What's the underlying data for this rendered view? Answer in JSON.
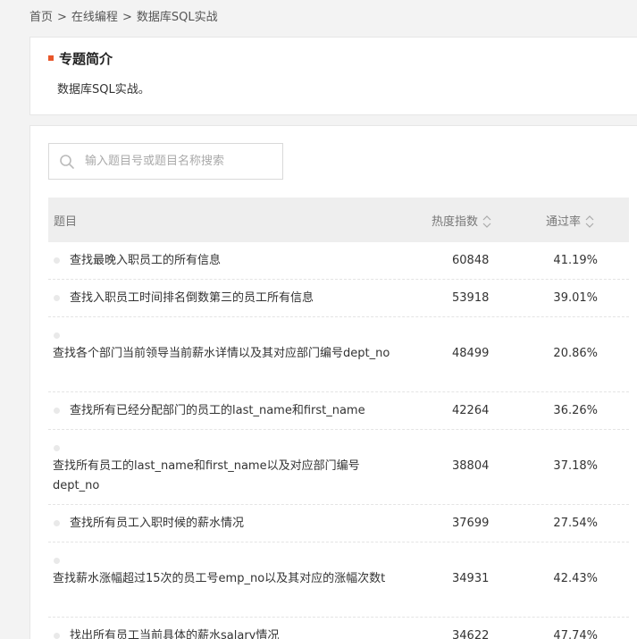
{
  "breadcrumb": {
    "home": "首页",
    "section": "在线编程",
    "current": "数据库SQL实战",
    "separator": ">"
  },
  "intro": {
    "title": "专题简介",
    "description": "数据库SQL实战。"
  },
  "search": {
    "placeholder": "输入题目号或题目名称搜索",
    "value": ""
  },
  "table": {
    "headers": {
      "title": "题目",
      "hotness": "热度指数",
      "pass_rate": "通过率"
    },
    "rows": [
      {
        "title": "查找最晚入职员工的所有信息",
        "hotness": "60848",
        "pass_rate": "41.19%"
      },
      {
        "title": "查找入职员工时间排名倒数第三的员工所有信息",
        "hotness": "53918",
        "pass_rate": "39.01%"
      },
      {
        "title": "查找各个部门当前领导当前薪水详情以及其对应部门编号dept_no",
        "hotness": "48499",
        "pass_rate": "20.86%"
      },
      {
        "title": "查找所有已经分配部门的员工的last_name和first_name",
        "hotness": "42264",
        "pass_rate": "36.26%"
      },
      {
        "title": "查找所有员工的last_name和first_name以及对应部门编号dept_no",
        "hotness": "38804",
        "pass_rate": "37.18%"
      },
      {
        "title": "查找所有员工入职时候的薪水情况",
        "hotness": "37699",
        "pass_rate": "27.54%"
      },
      {
        "title": "查找薪水涨幅超过15次的员工号emp_no以及其对应的涨幅次数t",
        "hotness": "34931",
        "pass_rate": "42.43%"
      },
      {
        "title": "找出所有员工当前具体的薪水salary情况",
        "hotness": "34622",
        "pass_rate": "47.74%"
      }
    ]
  },
  "colors": {
    "accent": "#e8562a",
    "header_bg": "#eeeeee",
    "page_bg": "#f3f3f3"
  },
  "icons": {
    "search": "search-icon",
    "sort": "sort-icon",
    "bullet": "bullet-dot-icon"
  }
}
